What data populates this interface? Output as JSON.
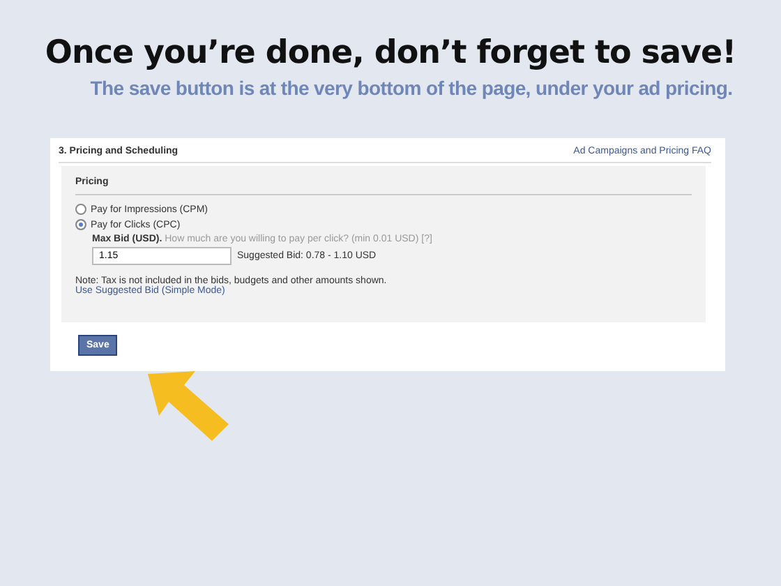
{
  "heading": "Once you’re done, don’t forget to save!",
  "subheading": "The save button is at the very bottom of the page, under your ad pricing.",
  "screenshot": {
    "section_title": "3. Pricing and Scheduling",
    "faq_link": "Ad Campaigns and Pricing FAQ",
    "pricing_title": "Pricing",
    "options": [
      {
        "label": "Pay for Impressions (CPM)",
        "selected": false
      },
      {
        "label": "Pay for Clicks (CPC)",
        "selected": true
      }
    ],
    "bid_label": "Max Bid (USD).",
    "bid_question": "How much are you willing to pay per click? (min 0.01 USD)",
    "help": "[?]",
    "bid_value": "1.15",
    "suggested": "Suggested Bid: 0.78 - 1.10 USD",
    "note": "Note: Tax is not included in the bids, budgets and other amounts shown.",
    "simple_mode_link": "Use Suggested Bid (Simple Mode)",
    "save_button": "Save"
  }
}
